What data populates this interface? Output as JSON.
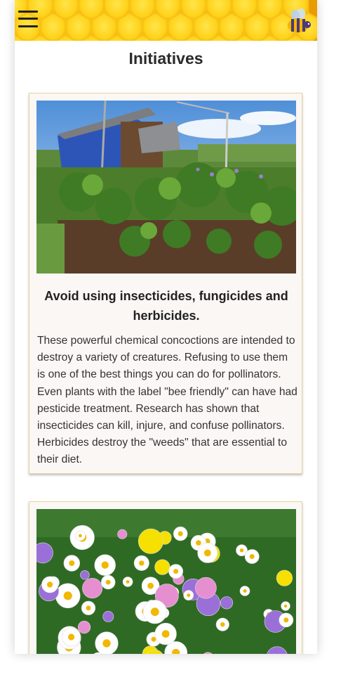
{
  "header": {
    "menu_icon": "hamburger-menu-icon",
    "logo_icon": "bee-icon",
    "colors": {
      "honey": "#f3b200",
      "comb_light": "#ffd21f",
      "comb_edge": "#e09a00"
    }
  },
  "page": {
    "title": "Initiatives"
  },
  "cards": [
    {
      "image": "allotment-garden-photo",
      "title": "Avoid using insecticides, fungicides and herbicides.",
      "text": "These powerful chemical concoctions are intended to destroy a variety of creatures. Refusing to use them is one of the best things you can do for pollinators. Even plants with the label \"bee friendly\" can have had pesticide treatment. Research has shown that insecticides can kill, injure, and confuse pollinators. Herbicides destroy the \"weeds\" that are essential to their diet."
    },
    {
      "image": "wildflower-meadow-photo"
    }
  ]
}
